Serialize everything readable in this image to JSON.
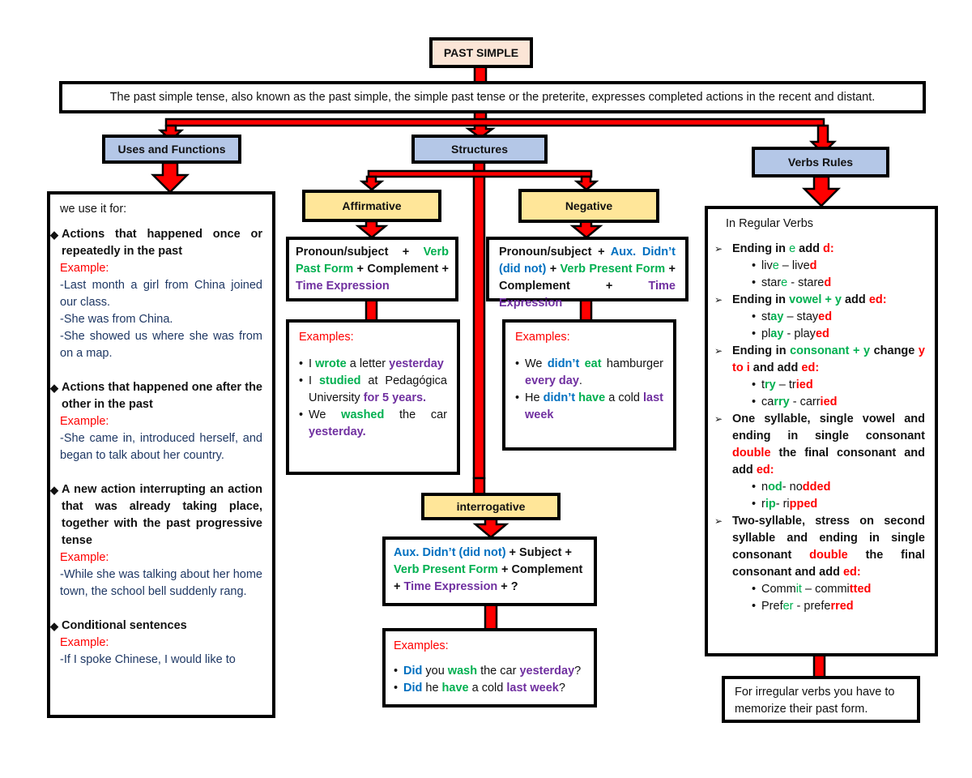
{
  "title": "PAST SIMPLE",
  "definition": "The past simple tense, also known as the past simple, the simple past tense or the preterite, expresses completed actions in the recent and distant.",
  "colors": {
    "arrow": "#ff0000",
    "title_bg": "#fbe5d6",
    "category_bg": "#b4c7e7",
    "structure_bg": "#ffe699",
    "example_label": "#ff0000",
    "verb": "#00b050",
    "time": "#7030a0",
    "aux": "#0070c0",
    "sample": "#1f3864"
  },
  "uses": {
    "header": "Uses and Functions",
    "intro": "we use it for:",
    "items": [
      {
        "heading": "Actions that happened once or repeatedly in the past",
        "example_label": "Example:",
        "examples": [
          "-Last month a girl from China joined our class.",
          "-She was from China.",
          "-She showed us where she was from on a map."
        ]
      },
      {
        "heading": "Actions that happened one after the other in the past",
        "example_label": "Example:",
        "examples": [
          "-She came in, introduced herself, and began to talk about her country."
        ]
      },
      {
        "heading": "A new action interrupting an action that was already taking place, together with the past progressive tense",
        "example_label": "Example:",
        "examples": [
          "-While she was talking about her home town, the school bell suddenly rang."
        ]
      },
      {
        "heading": "Conditional sentences",
        "example_label": "Example:",
        "examples": [
          "-If I spoke Chinese, I would like to"
        ]
      }
    ]
  },
  "structures": {
    "header": "Structures",
    "affirmative": {
      "header": "Affirmative",
      "formula": {
        "p1": "Pronoun/subject  + ",
        "verb": "Verb Past Form",
        "p2": " + Complement + ",
        "time": "Time Expression"
      },
      "examples_label": "Examples:",
      "examples": [
        {
          "a": "I ",
          "v": "wrote",
          "b": " a letter ",
          "t": "yesterday",
          "c": ""
        },
        {
          "a": "I ",
          "v": "studied",
          "b": " at Pedagógica University ",
          "t": "for 5 years.",
          "c": ""
        },
        {
          "a": "We ",
          "v": "washed",
          "b": " the car ",
          "t": "yesterday.",
          "c": ""
        }
      ]
    },
    "negative": {
      "header": "Negative",
      "formula": {
        "p1": "Pronoun/subject + ",
        "aux": "Aux. Didn’t (did not)",
        "p2": " + ",
        "verb": "Verb Present Form",
        "p3": " + Complement + ",
        "time": "Time Expression"
      },
      "examples_label": "Examples:",
      "examples": [
        {
          "a": "We ",
          "x": "didn’t",
          "m": " ",
          "v": "eat",
          "b": " hamburger ",
          "t": "every day",
          "c": "."
        },
        {
          "a": "He ",
          "x": "didn’t",
          "m": " ",
          "v": "have",
          "b": " a cold ",
          "t": "last week",
          "c": ""
        }
      ]
    },
    "interrogative": {
      "header": "interrogative",
      "formula": {
        "aux": "Aux. Didn’t (did not)",
        "p1": " + Subject + ",
        "verb": "Verb Present Form",
        "p2": " + Complement + ",
        "time": "Time Expression",
        "p3": " + ?"
      },
      "examples_label": "Examples:",
      "examples": [
        {
          "x": "Did",
          "a": " you ",
          "v": "wash",
          "b": " the car ",
          "t": "yesterday",
          "c": "?"
        },
        {
          "x": "Did",
          "a": " he ",
          "v": "have",
          "b": " a cold ",
          "t": "last week",
          "c": "?"
        }
      ]
    }
  },
  "verbs_rules": {
    "header": "Verbs Rules",
    "intro": "In Regular Verbs",
    "irregular_note": "For irregular verbs you have to memorize their past form."
  }
}
